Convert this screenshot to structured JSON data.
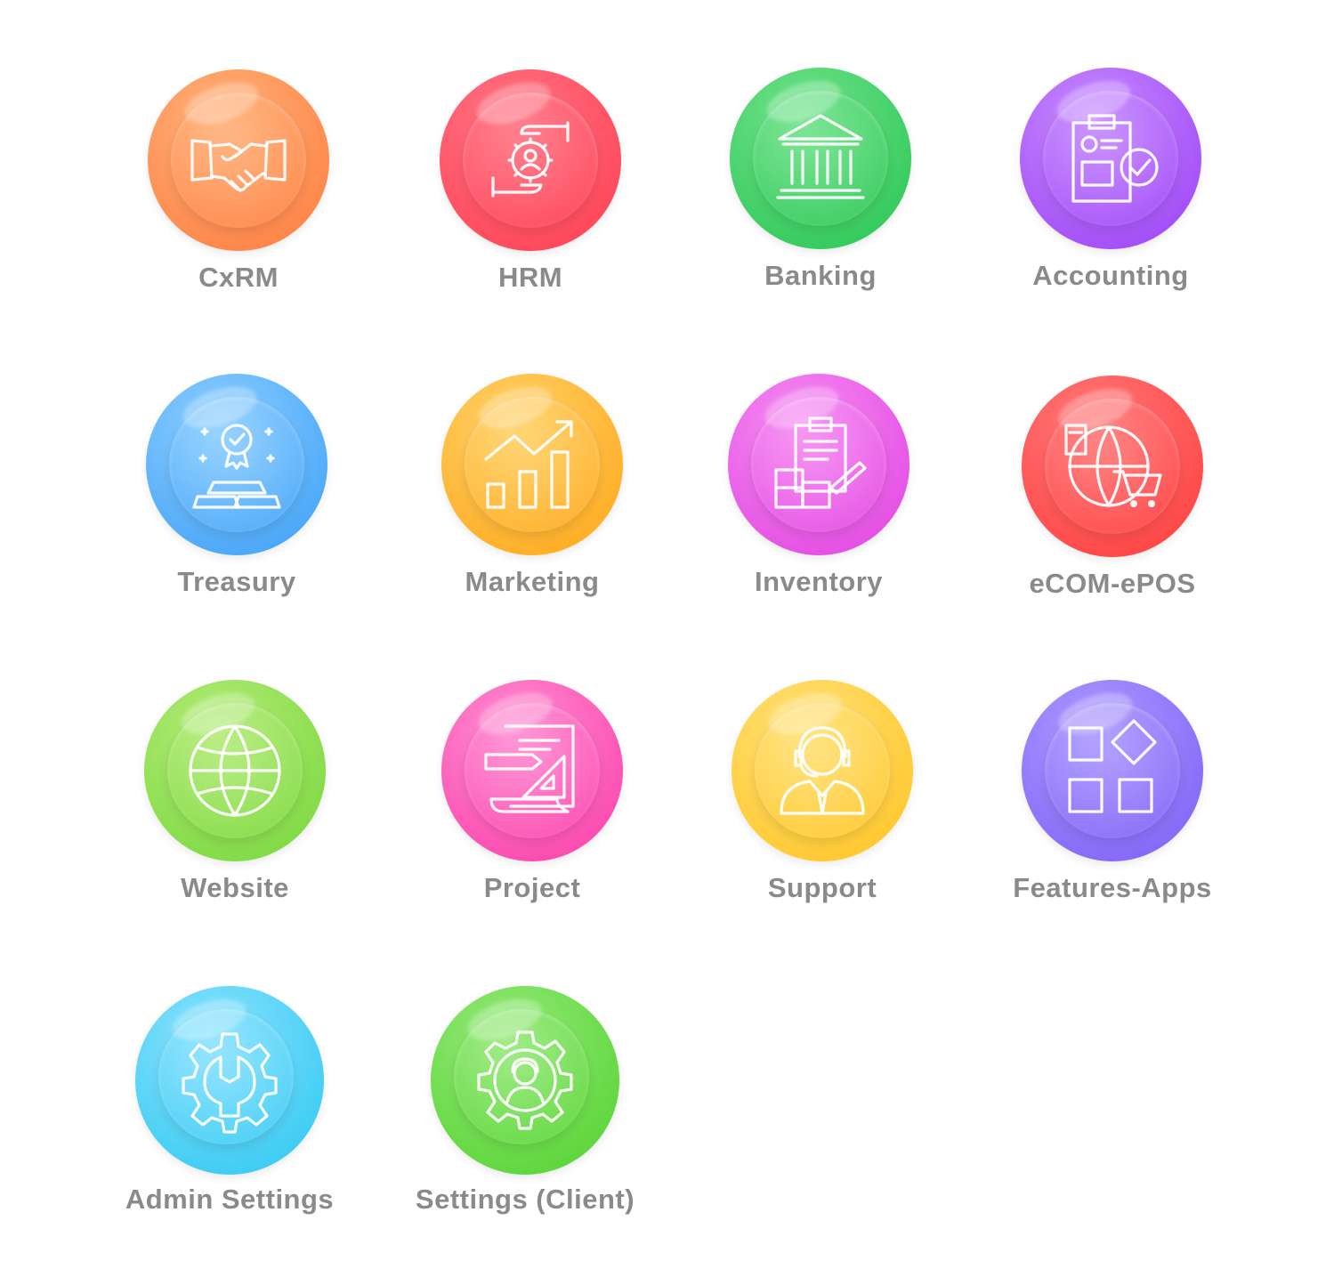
{
  "modules": [
    {
      "label": "CxRM",
      "icon": "handshake-icon",
      "colors": [
        "#ffb37a",
        "#ff7a3d"
      ]
    },
    {
      "label": "HRM",
      "icon": "hr-hands-gear-icon",
      "colors": [
        "#ff7585",
        "#ff3c4f"
      ]
    },
    {
      "label": "Banking",
      "icon": "bank-building-icon",
      "colors": [
        "#73e38c",
        "#25c451"
      ]
    },
    {
      "label": "Accounting",
      "icon": "clipboard-check-icon",
      "colors": [
        "#c78cff",
        "#9b3ef5"
      ]
    },
    {
      "label": "Treasury",
      "icon": "gold-bars-award-icon",
      "colors": [
        "#8fd0ff",
        "#3a9df7"
      ]
    },
    {
      "label": "Marketing",
      "icon": "growth-chart-icon",
      "colors": [
        "#ffd36b",
        "#ffa414"
      ]
    },
    {
      "label": "Inventory",
      "icon": "boxes-clipboard-icon",
      "colors": [
        "#f68ef2",
        "#e03fe0"
      ]
    },
    {
      "label": "eCOM-ePOS",
      "icon": "globe-cart-icon",
      "colors": [
        "#ff7a7a",
        "#ff3a3a"
      ]
    },
    {
      "label": "Website",
      "icon": "globe-icon",
      "colors": [
        "#b6ec7a",
        "#74d639"
      ]
    },
    {
      "label": "Project",
      "icon": "blueprint-ruler-icon",
      "colors": [
        "#ff8fd4",
        "#fb3aa6"
      ]
    },
    {
      "label": "Support",
      "icon": "support-agent-icon",
      "colors": [
        "#ffe27a",
        "#ffc21e"
      ]
    },
    {
      "label": "Features-Apps",
      "icon": "app-blocks-icon",
      "colors": [
        "#ad9bff",
        "#7a5cf5"
      ]
    },
    {
      "label": "Admin Settings",
      "icon": "gear-wrench-icon",
      "colors": [
        "#8ee3ff",
        "#29c6f0"
      ]
    },
    {
      "label": "Settings (Client)",
      "icon": "gear-person-icon",
      "colors": [
        "#98ea7c",
        "#4fd12b"
      ]
    }
  ]
}
